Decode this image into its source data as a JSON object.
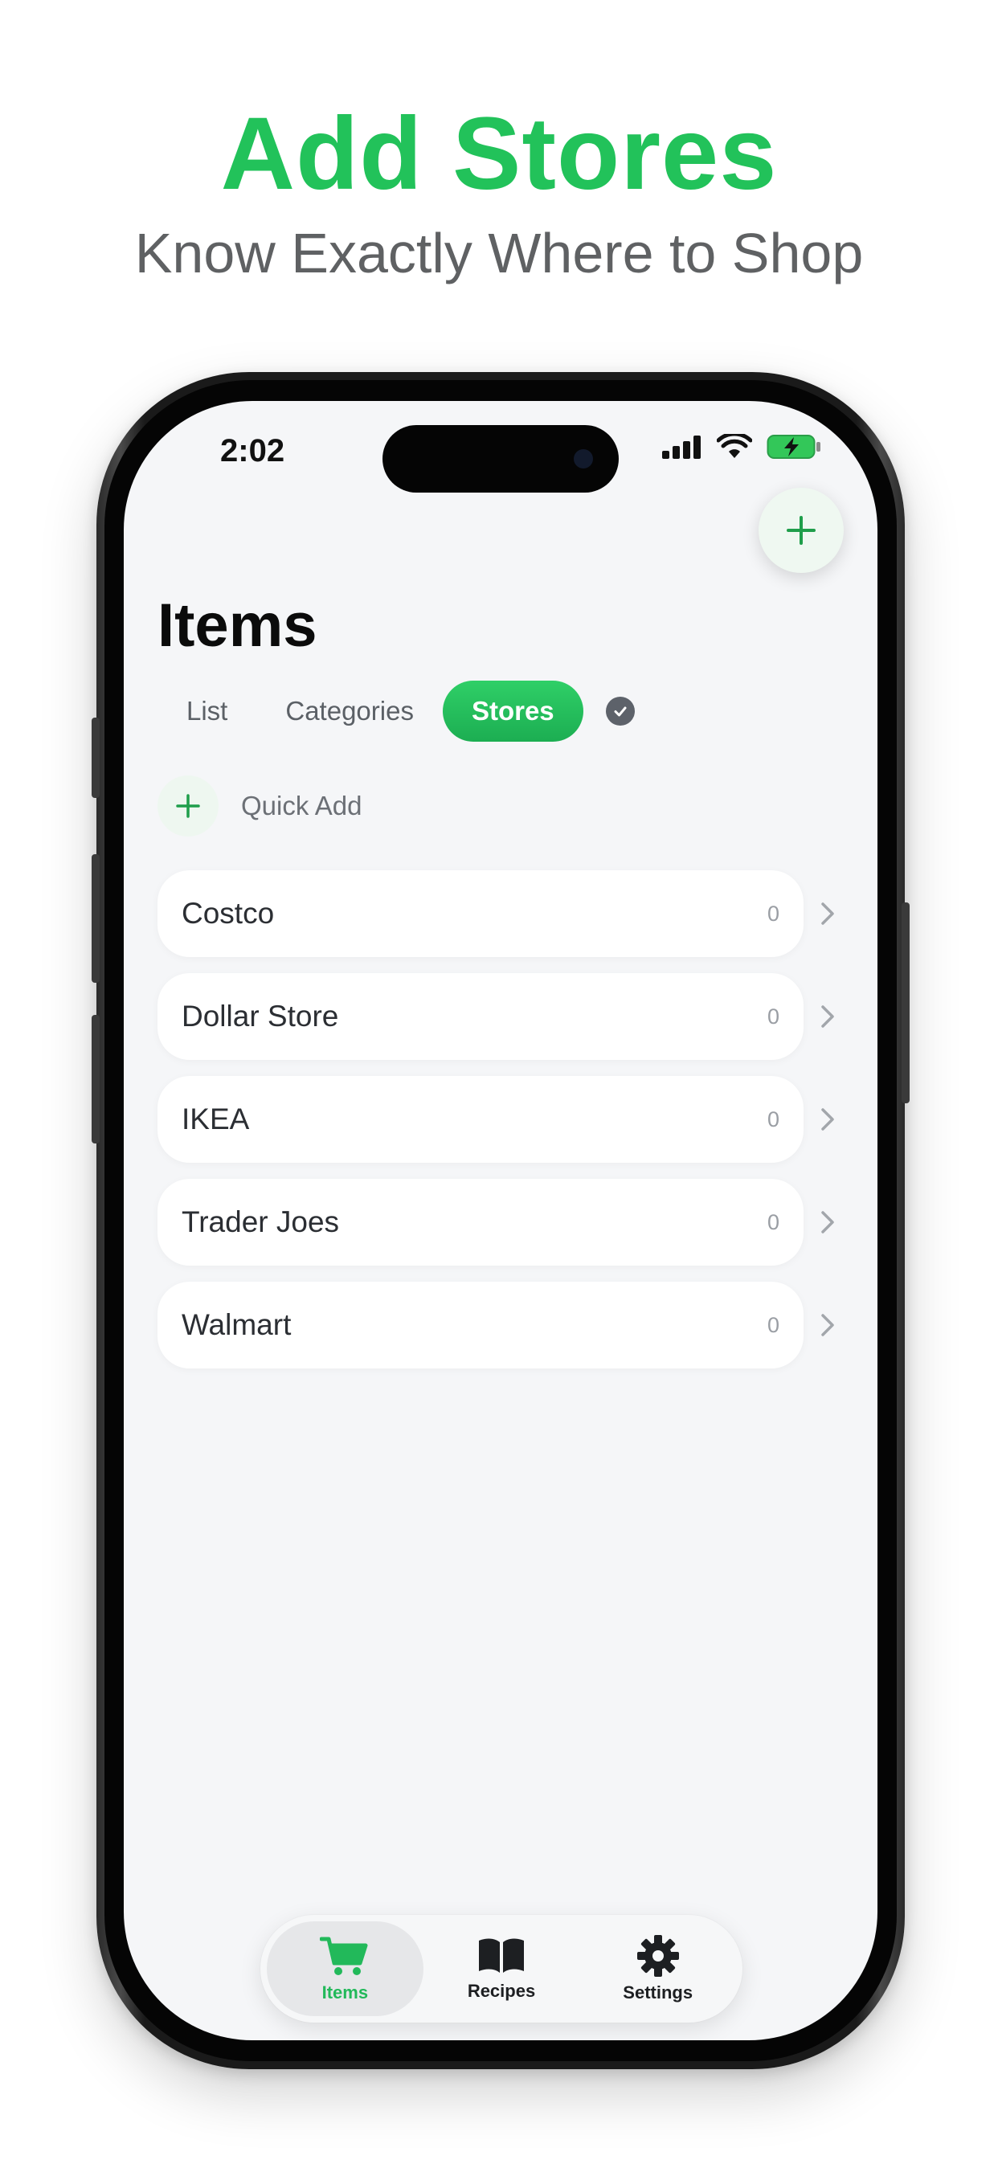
{
  "promo": {
    "title": "Add Stores",
    "subtitle": "Know Exactly Where to Shop"
  },
  "colors": {
    "accent": "#22c25a",
    "background": "#f5f6f8"
  },
  "status_bar": {
    "time": "2:02",
    "icons": [
      "signal-icon",
      "wifi-icon",
      "battery-charging-icon"
    ]
  },
  "header": {
    "add_icon": "plus-icon",
    "title": "Items"
  },
  "tabs": [
    {
      "label": "List",
      "active": false
    },
    {
      "label": "Categories",
      "active": false
    },
    {
      "label": "Stores",
      "active": true
    }
  ],
  "tabs_extra_icon": "checkmark-circle-icon",
  "quick_add": {
    "icon": "plus-icon",
    "label": "Quick Add"
  },
  "stores": [
    {
      "name": "Costco",
      "count": "0"
    },
    {
      "name": "Dollar Store",
      "count": "0"
    },
    {
      "name": "IKEA",
      "count": "0"
    },
    {
      "name": "Trader Joes",
      "count": "0"
    },
    {
      "name": "Walmart",
      "count": "0"
    }
  ],
  "bottom_nav": [
    {
      "label": "Items",
      "icon": "cart-icon",
      "active": true
    },
    {
      "label": "Recipes",
      "icon": "book-icon",
      "active": false
    },
    {
      "label": "Settings",
      "icon": "gear-icon",
      "active": false
    }
  ]
}
